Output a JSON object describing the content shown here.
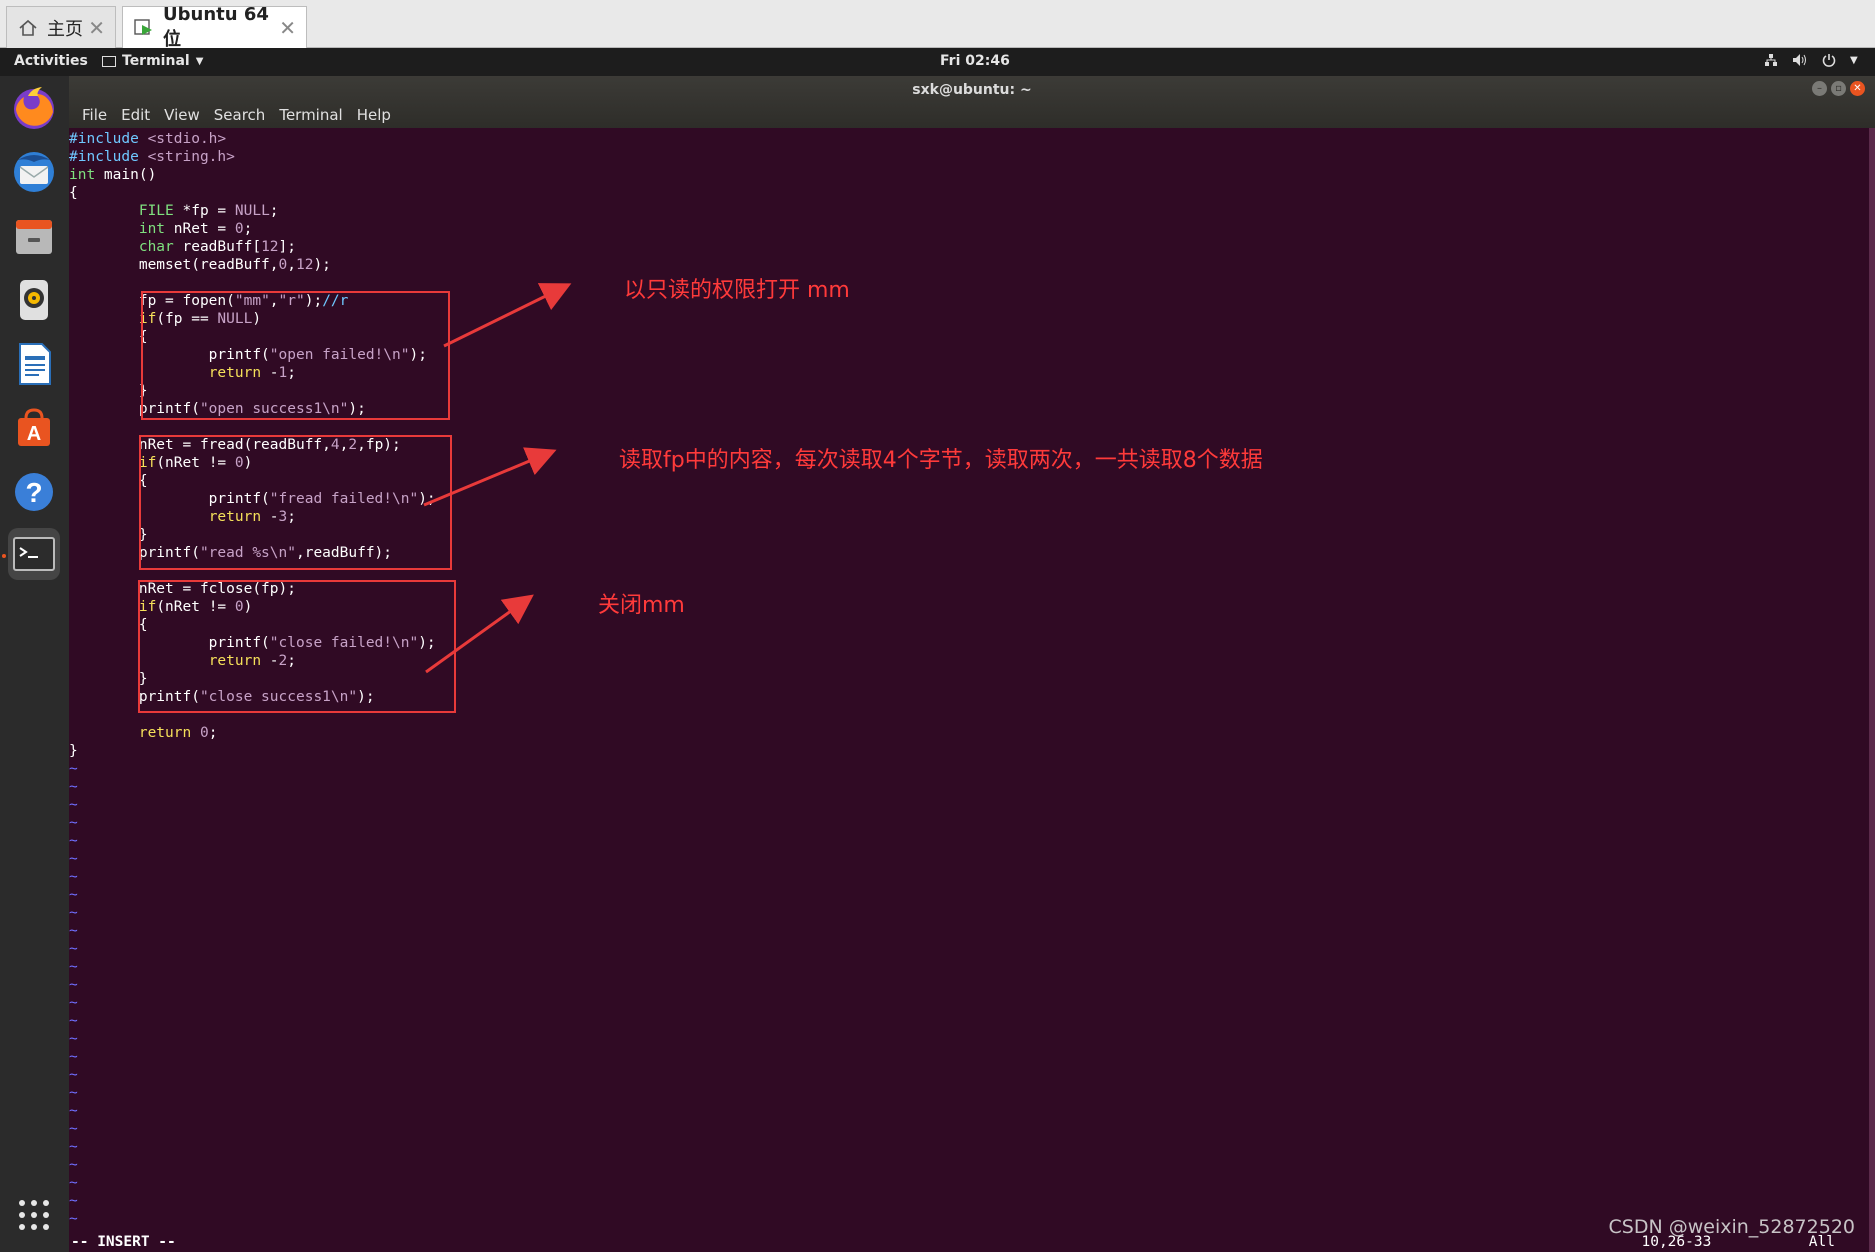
{
  "vm_tabs": [
    {
      "label": "主页",
      "icon": "home-icon"
    },
    {
      "label": "Ubuntu 64 位",
      "icon": "vm-icon"
    }
  ],
  "topbar": {
    "activities": "Activities",
    "app_menu": "Terminal",
    "clock": "Fri 02:46"
  },
  "terminal": {
    "title": "sxk@ubuntu: ~",
    "menu": [
      "File",
      "Edit",
      "View",
      "Search",
      "Terminal",
      "Help"
    ]
  },
  "dock_items": [
    "firefox-icon",
    "thunderbird-icon",
    "files-icon",
    "rhythmbox-icon",
    "writer-icon",
    "software-icon",
    "help-icon",
    "terminal-icon"
  ],
  "code_lines": [
    "#include <stdio.h>",
    "#include <string.h>",
    "int main()",
    "{",
    "        FILE *fp = NULL;",
    "        int nRet = 0;",
    "        char readBuff[12];",
    "        memset(readBuff,0,12);",
    "",
    "        fp = fopen(\"mm\",\"r\");//r",
    "        if(fp == NULL)",
    "        {",
    "                printf(\"open failed!\\n\");",
    "                return -1;",
    "        }",
    "        printf(\"open success1\\n\");",
    "",
    "        nRet = fread(readBuff,4,2,fp);",
    "        if(nRet != 0)",
    "        {",
    "                printf(\"fread failed!\\n\");",
    "                return -3;",
    "        }",
    "        printf(\"read %s\\n\",readBuff);",
    "",
    "        nRet = fclose(fp);",
    "        if(nRet != 0)",
    "        {",
    "                printf(\"close failed!\\n\");",
    "                return -2;",
    "        }",
    "        printf(\"close success1\\n\");",
    "",
    "        return 0;",
    "}"
  ],
  "tilde_count": 26,
  "status": {
    "mode": "-- INSERT --",
    "position": "10,26-33",
    "scroll": "All"
  },
  "annotations": [
    "以只读的权限打开 mm",
    "读取fp中的内容，每次读取4个字节，读取两次，一共读取8个数据",
    "关闭mm"
  ],
  "watermark": "CSDN @weixin_52872520",
  "colors": {
    "terminal_bg": "#300a24",
    "annotation_red": "#e83a3a",
    "ubuntu_orange": "#e95420"
  }
}
